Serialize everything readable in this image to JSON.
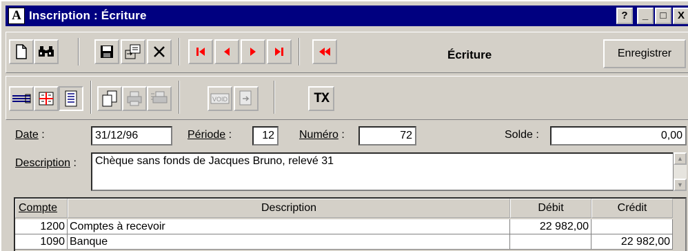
{
  "window": {
    "title": "Inscription : Écriture",
    "app_icon_letter": "A",
    "help_label": "?",
    "minimize_label": "_",
    "maximize_label": "□",
    "close_label": "X"
  },
  "toolbar": {
    "mode_label": "Écriture",
    "save_label": "Enregistrer",
    "tax_label": "TX"
  },
  "form": {
    "date_label": "Date",
    "date_value": "31/12/96",
    "periode_label": "Période",
    "periode_value": "12",
    "numero_label": "Numéro",
    "numero_value": "72",
    "solde_label": "Solde",
    "solde_value": "0,00",
    "description_label": "Description",
    "description_value": "Chèque sans fonds de Jacques Bruno, relevé 31"
  },
  "table": {
    "headers": [
      "Compte",
      "Description",
      "Débit",
      "Crédit"
    ],
    "rows": [
      {
        "compte": "1200",
        "description": "Comptes à recevoir",
        "debit": "22 982,00",
        "credit": ""
      },
      {
        "compte": "1090",
        "description": "Banque",
        "debit": "",
        "credit": "22 982,00"
      }
    ]
  },
  "colors": {
    "titlebar": "#000080",
    "face": "#d4d0c8",
    "nav_arrow": "#ff0000"
  }
}
